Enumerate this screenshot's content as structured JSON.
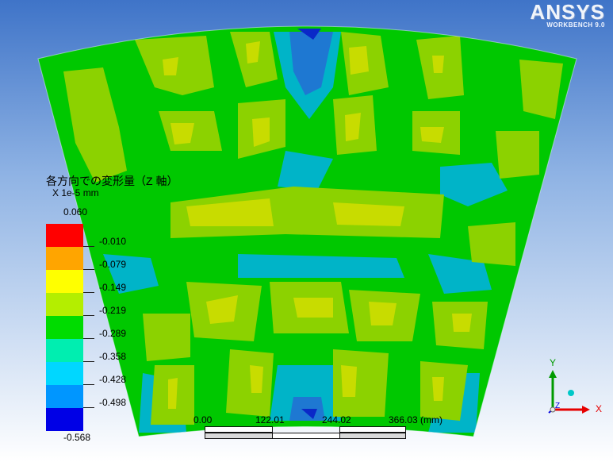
{
  "branding": {
    "logo_text": "ANSYS",
    "logo_subtext": "WORKBENCH 9.0"
  },
  "legend": {
    "title": "各方向での変形量（Z 軸）",
    "units": "X 1e-5 mm",
    "max_label": "0.060",
    "min_label": "-0.568",
    "levels": [
      "-0.010",
      "-0.079",
      "-0.149",
      "-0.219",
      "-0.289",
      "-0.358",
      "-0.428",
      "-0.498"
    ],
    "colors": [
      "#ff0000",
      "#ffa500",
      "#ffff00",
      "#b4ee00",
      "#00dc00",
      "#00eeb0",
      "#00d7ff",
      "#0096ff",
      "#0000e6"
    ]
  },
  "scale": {
    "labels": [
      "0.00",
      "122.01",
      "244.02",
      "366.03 (mm)"
    ]
  },
  "triad": {
    "x_label": "X",
    "y_label": "Y",
    "z_label": "Z",
    "x_color": "#e60000",
    "y_color": "#009a00",
    "z_color": "#0000e0"
  },
  "contour": {
    "field_colors": [
      "#00c800",
      "#8cd200",
      "#c8dc00",
      "#00b4c8",
      "#1e78d2",
      "#0a28c8"
    ]
  }
}
